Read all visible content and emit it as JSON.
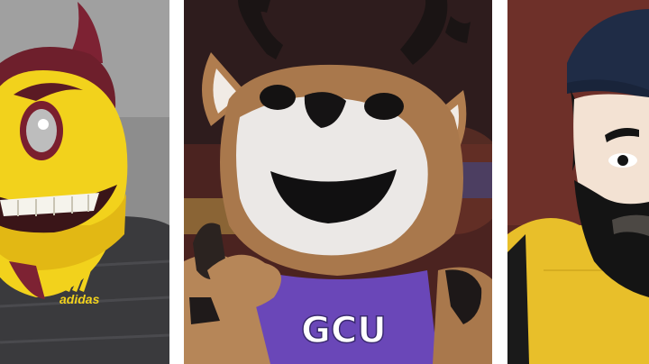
{
  "panels": [
    {
      "id": "left",
      "subject": "sun-devil-mascot",
      "visible_text": "adidas",
      "colors": {
        "face": "#f2d21c",
        "horn": "#7d2233",
        "background": "#8a8a8a",
        "jersey": "#3b3b3d"
      }
    },
    {
      "id": "center",
      "subject": "antelope-mascot",
      "visible_text": "GCU",
      "colors": {
        "fur": "#a9784c",
        "muzzle": "#e9e6e4",
        "antler": "#1a1414",
        "jersey": "#6a47b8",
        "background": "#5a2a22"
      }
    },
    {
      "id": "right",
      "subject": "lumberjack-mascot",
      "colors": {
        "beanie": "#1f2c46",
        "skin": "#f3e2d3",
        "beard": "#141414",
        "shirt": "#e8bf2a",
        "background": "#6b2a24"
      }
    }
  ],
  "divider_color": "#ffffff"
}
